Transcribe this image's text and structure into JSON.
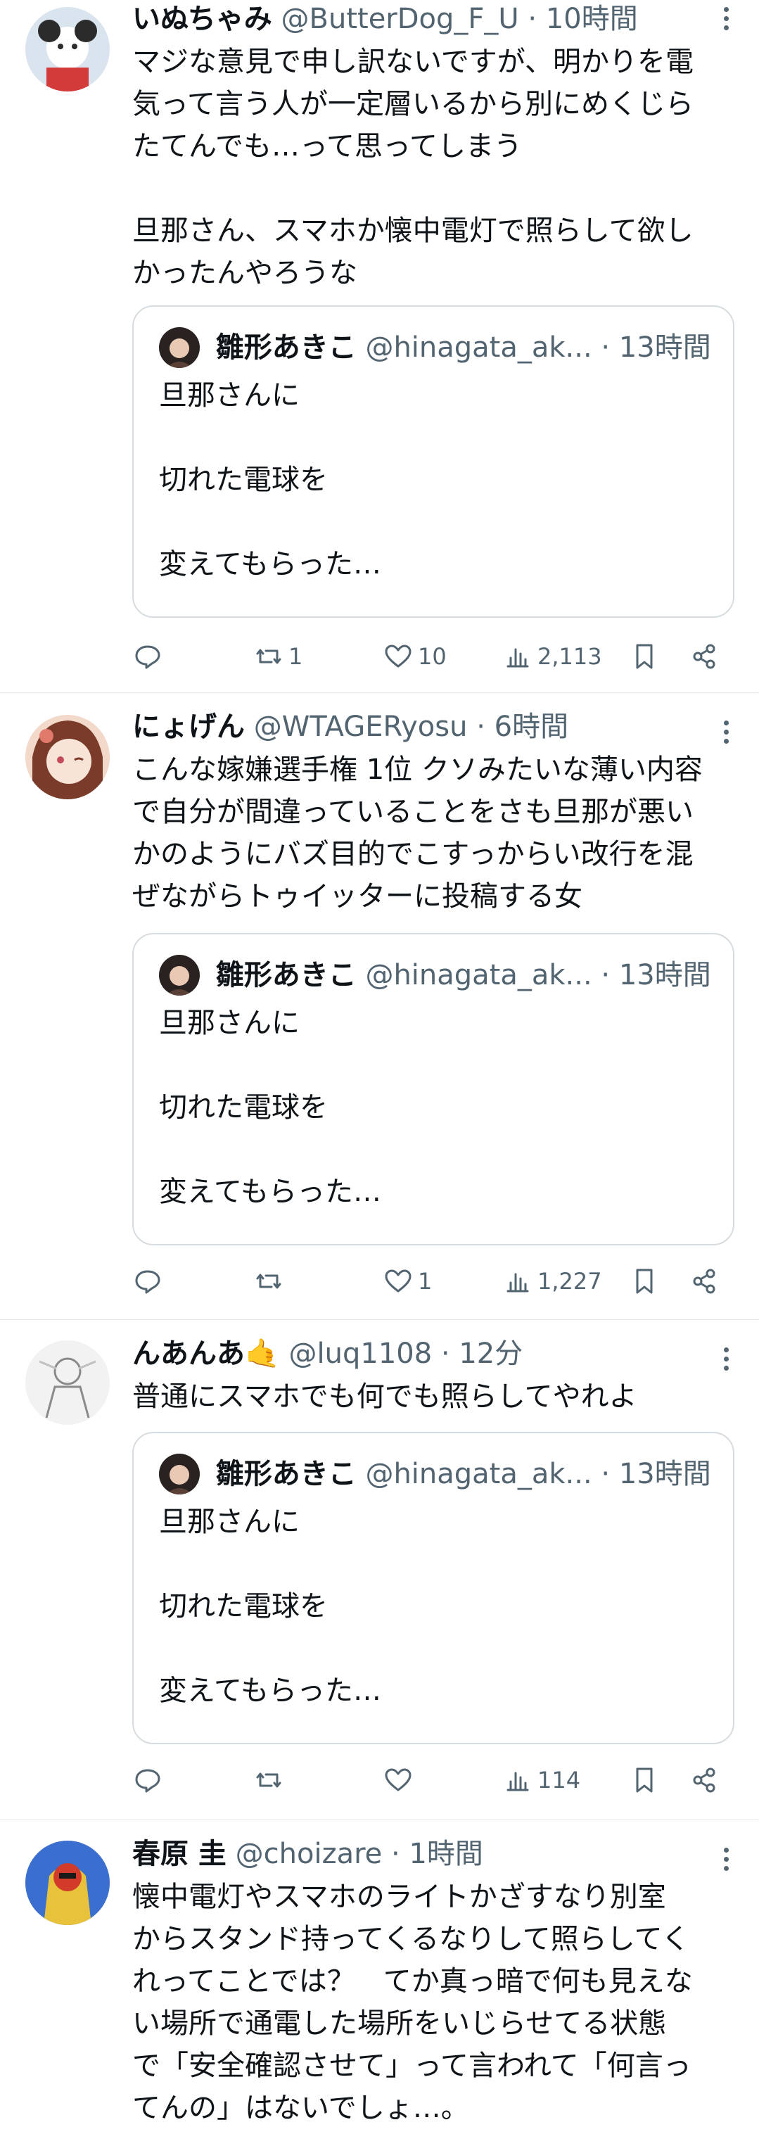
{
  "tweets": [
    {
      "name": "いぬちゃみ",
      "handle": "@ButterDog_F_U",
      "sep": "·",
      "time": "10時間",
      "text": "マジな意見で申し訳ないですが、明かりを電\n気って言う人が一定層いるから別にめくじら\nたてんでも…って思ってしまう\n\n旦那さん、スマホか懐中電灯で照らして欲し\nかったんやろうな",
      "quote": {
        "name": "雛形あきこ",
        "handle": "@hinagata_ak...",
        "sep": "·",
        "time": "13時間",
        "text": "旦那さんに\n\n切れた電球を\n\n変えてもらった…"
      },
      "counts": {
        "reply": "",
        "retweet": "1",
        "like": "10",
        "views": "2,113"
      },
      "avatar_colors": {
        "bg": "#d9e4ef",
        "fg": "#2b2b2b",
        "accent": "#d33a3a"
      }
    },
    {
      "name": "にょげん",
      "handle": "@WTAGERyosu",
      "sep": "·",
      "time": "6時間",
      "text": "こんな嫁嫌選手権 1位 クソみたいな薄い内容\nで自分が間違っていることをさも旦那が悪い\nかのようにバズ目的でこすっからい改行を混\nぜながらトゥイッターに投稿する女",
      "quote": {
        "name": "雛形あきこ",
        "handle": "@hinagata_ak...",
        "sep": "·",
        "time": "13時間",
        "text": "旦那さんに\n\n切れた電球を\n\n変えてもらった…"
      },
      "counts": {
        "reply": "",
        "retweet": "",
        "like": "1",
        "views": "1,227"
      },
      "avatar_colors": {
        "bg": "#f3d9c9",
        "fg": "#7a3b2a",
        "accent": "#e07a6a"
      }
    },
    {
      "name": "んあんあ🤙",
      "handle": "@luq1108",
      "sep": "·",
      "time": "12分",
      "text": "普通にスマホでも何でも照らしてやれよ",
      "quote": {
        "name": "雛形あきこ",
        "handle": "@hinagata_ak...",
        "sep": "·",
        "time": "13時間",
        "text": "旦那さんに\n\n切れた電球を\n\n変えてもらった…"
      },
      "counts": {
        "reply": "",
        "retweet": "",
        "like": "",
        "views": "114"
      },
      "avatar_colors": {
        "bg": "#f2f2f2",
        "fg": "#8a8a8a",
        "accent": "#c0c0c0"
      }
    },
    {
      "name": "春原 圭",
      "handle": "@choizare",
      "sep": "·",
      "time": "1時間",
      "text": "懐中電灯やスマホのライトかざすなり別室\nからスタンド持ってくるなりして照らしてく\nれってことでは？　てか真っ暗で何も見えな\nい場所で通電した場所をいじらせてる状態\nで「安全確認させて」って言われて「何言っ\nてんの」はないでしょ…。",
      "avatar_colors": {
        "bg": "#3a6fd0",
        "fg": "#e8c23a",
        "accent": "#d23a2a"
      }
    }
  ],
  "icons": [
    "reply-icon",
    "retweet-icon",
    "like-icon",
    "views-icon",
    "bookmark-icon",
    "share-icon",
    "more-icon"
  ],
  "colors": {
    "text": "#0f1419",
    "muted": "#536471",
    "border": "#d7dce0"
  }
}
